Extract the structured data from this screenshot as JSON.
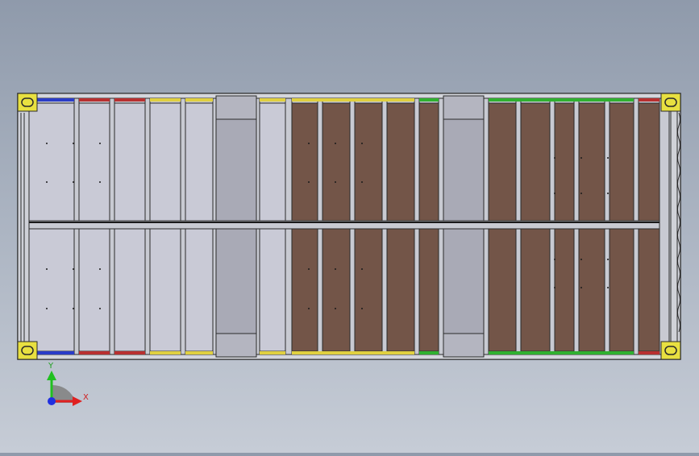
{
  "viewport": {
    "background_top": "#8f9aab",
    "background_bottom": "#c6ccd6",
    "model": "shipping-container-top-view"
  },
  "colors": {
    "frame": "#c8cad2",
    "outline": "#2a2a2a",
    "light_panel": "#c9cad6",
    "brown_panel": "#735548",
    "fork_pocket": "#a9aab6",
    "corner_casting": "#e8e040",
    "stripe_blue": "#2a3cc8",
    "stripe_red": "#b83030",
    "stripe_yellow": "#e0d040",
    "stripe_green": "#30b030"
  },
  "panels": {
    "left_section": "light",
    "middle_section": "brown",
    "right_section": "brown"
  },
  "triad": {
    "x_label": "X",
    "y_label": "Y",
    "x_color": "#e02020",
    "y_color": "#20c020",
    "z_color": "#2030e0"
  }
}
